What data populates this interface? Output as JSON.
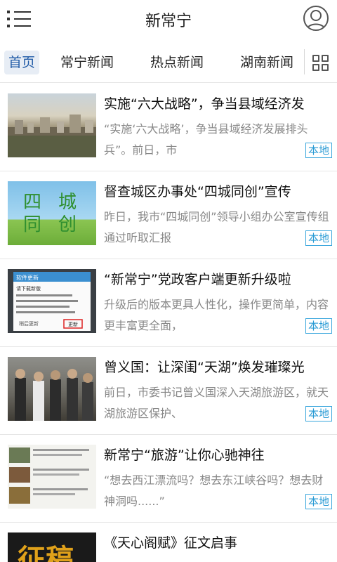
{
  "header": {
    "title": "新常宁"
  },
  "tabs": [
    {
      "label": "首页",
      "active": true
    },
    {
      "label": "常宁新闻",
      "active": false
    },
    {
      "label": "热点新闻",
      "active": false
    },
    {
      "label": "湖南新闻",
      "active": false
    }
  ],
  "news": [
    {
      "title": "实施“六大战略”，争当县域经济发",
      "summary": "“实施‘六大战略’，争当县域经济发展排头兵”。前日，市",
      "tag": "本地"
    },
    {
      "title": "督查城区办事处“四城同创”宣传",
      "summary": "昨日，我市“四城同创”领导小组办公室宣传组通过听取汇报",
      "tag": "本地",
      "thumb_text": [
        "四",
        "城",
        "同",
        "创"
      ]
    },
    {
      "title": "“新常宁”党政客户端更新升级啦",
      "summary": "升级后的版本更具人性化，操作更简单，内容更丰富更全面，",
      "tag": "本地",
      "thumb_text": [
        "软件更新",
        "请下载新版",
        "稍后更新",
        "更新"
      ]
    },
    {
      "title": "曾义国：让深闺“天湖”焕发璀璨光",
      "summary": "前日，市委书记曾义国深入天湖旅游区，就天湖旅游区保护、",
      "tag": "本地"
    },
    {
      "title": "新常宁“旅游”让你心驰神往",
      "summary": "“想去西江漂流吗？想去东江峡谷吗？想去财神洞吗......”",
      "tag": "本地"
    },
    {
      "title": "《天心阁赋》征文启事",
      "summary": "",
      "tag": "",
      "thumb_text": [
        "征稿"
      ]
    }
  ],
  "colors": {
    "accent": "#1f5aa6",
    "tag": "#2a9bd5"
  },
  "icons": {
    "menu": "menu-icon",
    "avatar": "user-avatar-icon",
    "grid": "grid-icon"
  }
}
